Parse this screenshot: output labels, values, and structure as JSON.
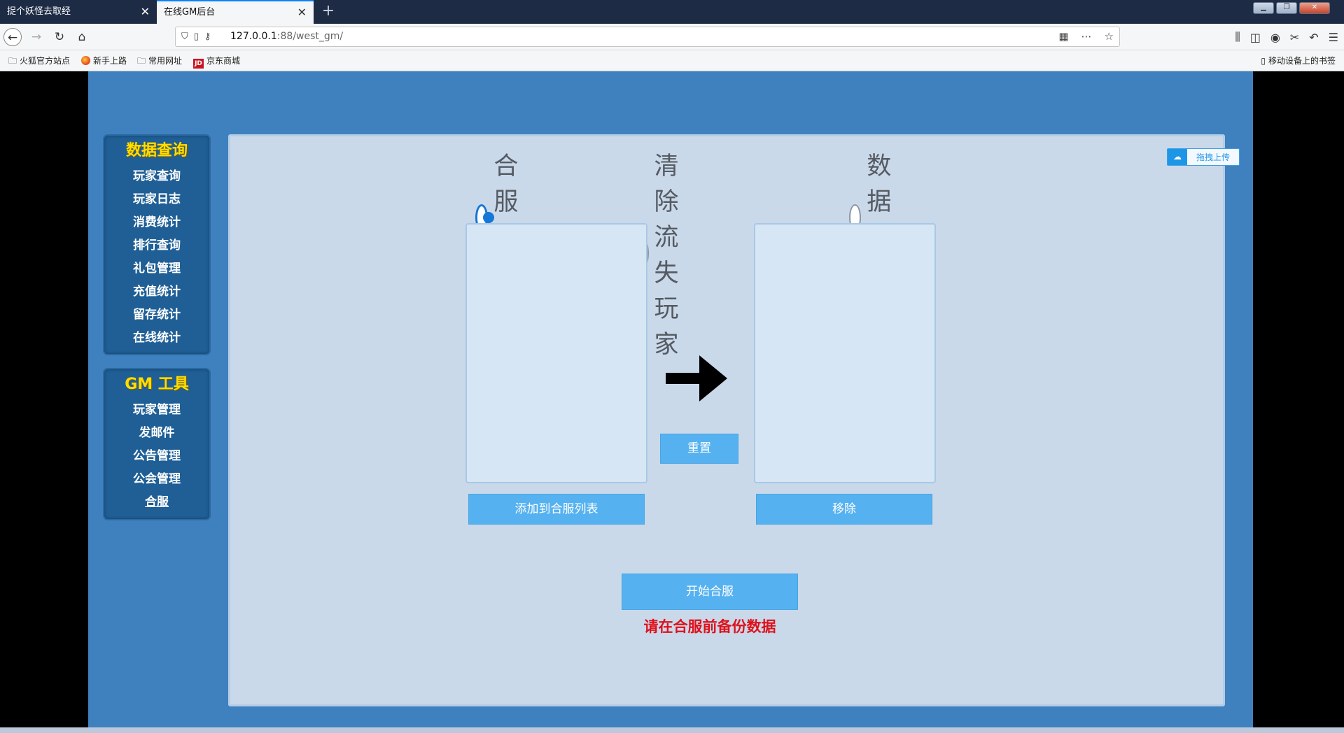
{
  "browser": {
    "tabs": [
      {
        "title": "捉个妖怪去取经",
        "close": "✕"
      },
      {
        "title": "在线GM后台",
        "close": "✕"
      }
    ],
    "new_tab": "+",
    "url_host": "127.0.0.1",
    "url_rest": ":88/west_gm/",
    "bookmarks": [
      {
        "label": "火狐官方站点"
      },
      {
        "label": "新手上路"
      },
      {
        "label": "常用网址"
      },
      {
        "label": "京东商城"
      }
    ],
    "mobile_bookmarks": "移动设备上的书签"
  },
  "sidebar": {
    "query_title": "数据查询",
    "query_items": [
      "玩家查询",
      "玩家日志",
      "消费统计",
      "排行查询",
      "礼包管理",
      "充值统计",
      "留存统计",
      "在线统计"
    ],
    "gm_title": "GM 工具",
    "gm_items": [
      "玩家管理",
      "发邮件",
      "公告管理",
      "公会管理",
      "合服"
    ]
  },
  "main": {
    "radio_options": [
      {
        "label": "合服管理",
        "checked": true
      },
      {
        "label": "清除流失玩家",
        "checked": false
      },
      {
        "label": "数据备份",
        "checked": false
      }
    ],
    "upload_label": "拖拽上传",
    "add_button": "添加到合服列表",
    "remove_button": "移除",
    "reset_button": "重置",
    "start_button": "开始合服",
    "warning": "请在合服前备份数据"
  },
  "colors": {
    "page_bg": "#3f80bf",
    "panel_bg": "#c9d9ea",
    "button": "#55b1ef",
    "sidebar_title": "#ffde00",
    "warning": "#e0101a",
    "radio_checked": "#1677d6"
  }
}
